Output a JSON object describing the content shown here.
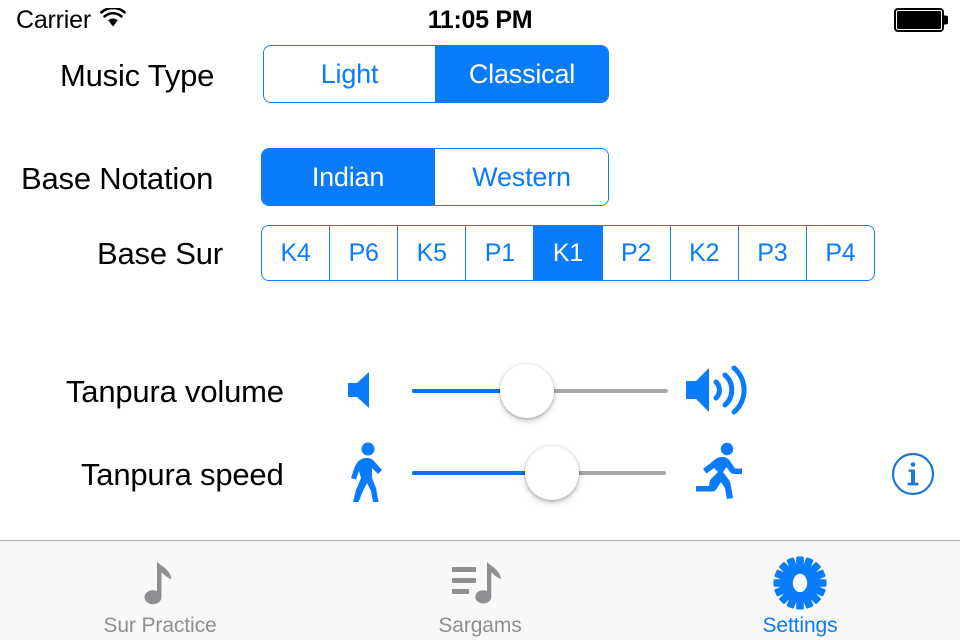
{
  "status_bar": {
    "carrier": "Carrier",
    "wifi_icon": "wifi-icon",
    "time": "11:05 PM",
    "battery_icon": "battery-full-icon"
  },
  "settings": {
    "music_type": {
      "label": "Music Type",
      "options": [
        "Light",
        "Classical"
      ],
      "selected": "Classical"
    },
    "base_notation": {
      "label": "Base Notation",
      "options": [
        "Indian",
        "Western"
      ],
      "selected": "Indian"
    },
    "base_sur": {
      "label": "Base Sur",
      "options": [
        "K4",
        "P6",
        "K5",
        "P1",
        "K1",
        "P2",
        "K2",
        "P3",
        "P4"
      ],
      "selected": "K1"
    },
    "tanpura_volume": {
      "label": "Tanpura volume",
      "min_icon": "speaker-mute-icon",
      "max_icon": "speaker-wave-icon",
      "value_percent": 45
    },
    "tanpura_speed": {
      "label": "Tanpura speed",
      "min_icon": "walking-person-icon",
      "max_icon": "running-person-icon",
      "value_percent": 55
    },
    "info_button": {
      "icon": "info-circle-icon",
      "label": "i"
    }
  },
  "tab_bar": {
    "items": [
      {
        "label": "Sur Practice",
        "icon": "music-note-icon",
        "selected": false
      },
      {
        "label": "Sargams",
        "icon": "music-list-icon",
        "selected": false
      },
      {
        "label": "Settings",
        "icon": "gear-icon",
        "selected": true
      }
    ]
  },
  "colors": {
    "accent": "#0a7bfa",
    "track_inactive": "#a8a8a8",
    "tab_inactive": "#8e8e93",
    "tab_bar_bg": "#f8f8f8"
  }
}
